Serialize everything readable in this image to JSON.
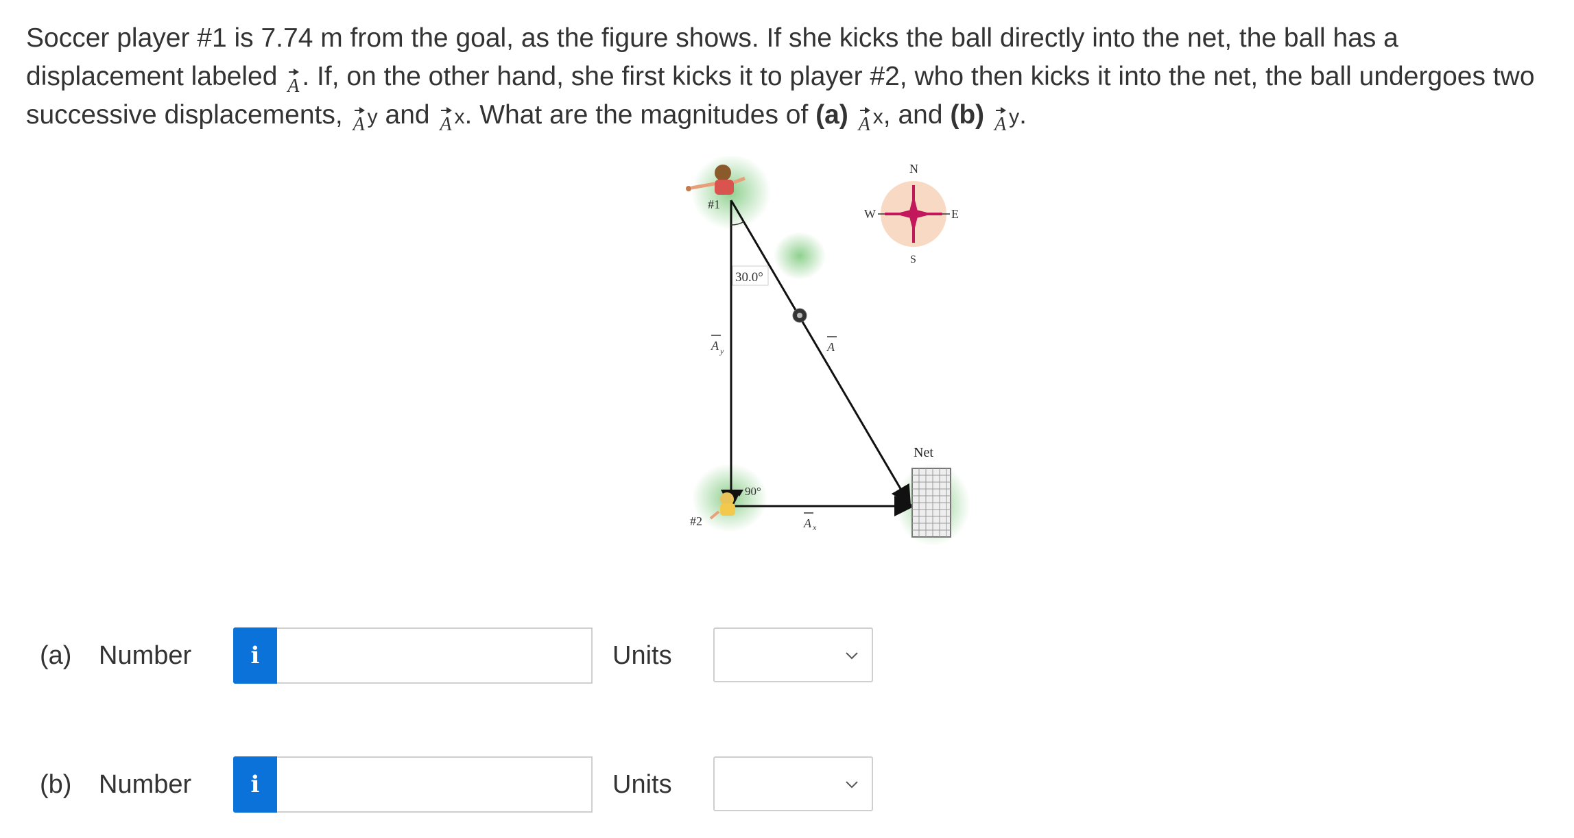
{
  "question": {
    "p1": "Soccer player #1 is 7.74 m from the goal, as the figure shows. If she kicks the ball directly into the net, the ball has a displacement labeled",
    "p2": ". If, on the other hand, she first kicks it to player #2, who then kicks it into the net, the ball undergoes two successive displacements,",
    "vec_letter": "A",
    "sub_y": "y",
    "sub_x": "x",
    "and": "and",
    "p3": ". What are the magnitudes of",
    "part_a": "(a)",
    "comma_and": ", and",
    "part_b": "(b)",
    "end": "."
  },
  "figure": {
    "player1": "#1",
    "player2": "#2",
    "angle_top": "30.0°",
    "angle_right": "90°",
    "vec_Ay": "A",
    "vec_Ay_sub": "y",
    "vec_A": "A",
    "vec_Ax": "A",
    "vec_Ax_sub": "x",
    "net": "Net",
    "compass_n": "N",
    "compass_s": "S",
    "compass_e": "E",
    "compass_w": "W"
  },
  "answers": [
    {
      "part": "(a)",
      "number_label": "Number",
      "info": "i",
      "value": "",
      "units_label": "Units",
      "units_value": ""
    },
    {
      "part": "(b)",
      "number_label": "Number",
      "info": "i",
      "value": "",
      "units_label": "Units",
      "units_value": ""
    }
  ],
  "colors": {
    "info_button": "#0a72d8",
    "field_glow": "#8fd08f",
    "compass_bg": "#f8d9c4",
    "compass_star": "#c2185b"
  }
}
